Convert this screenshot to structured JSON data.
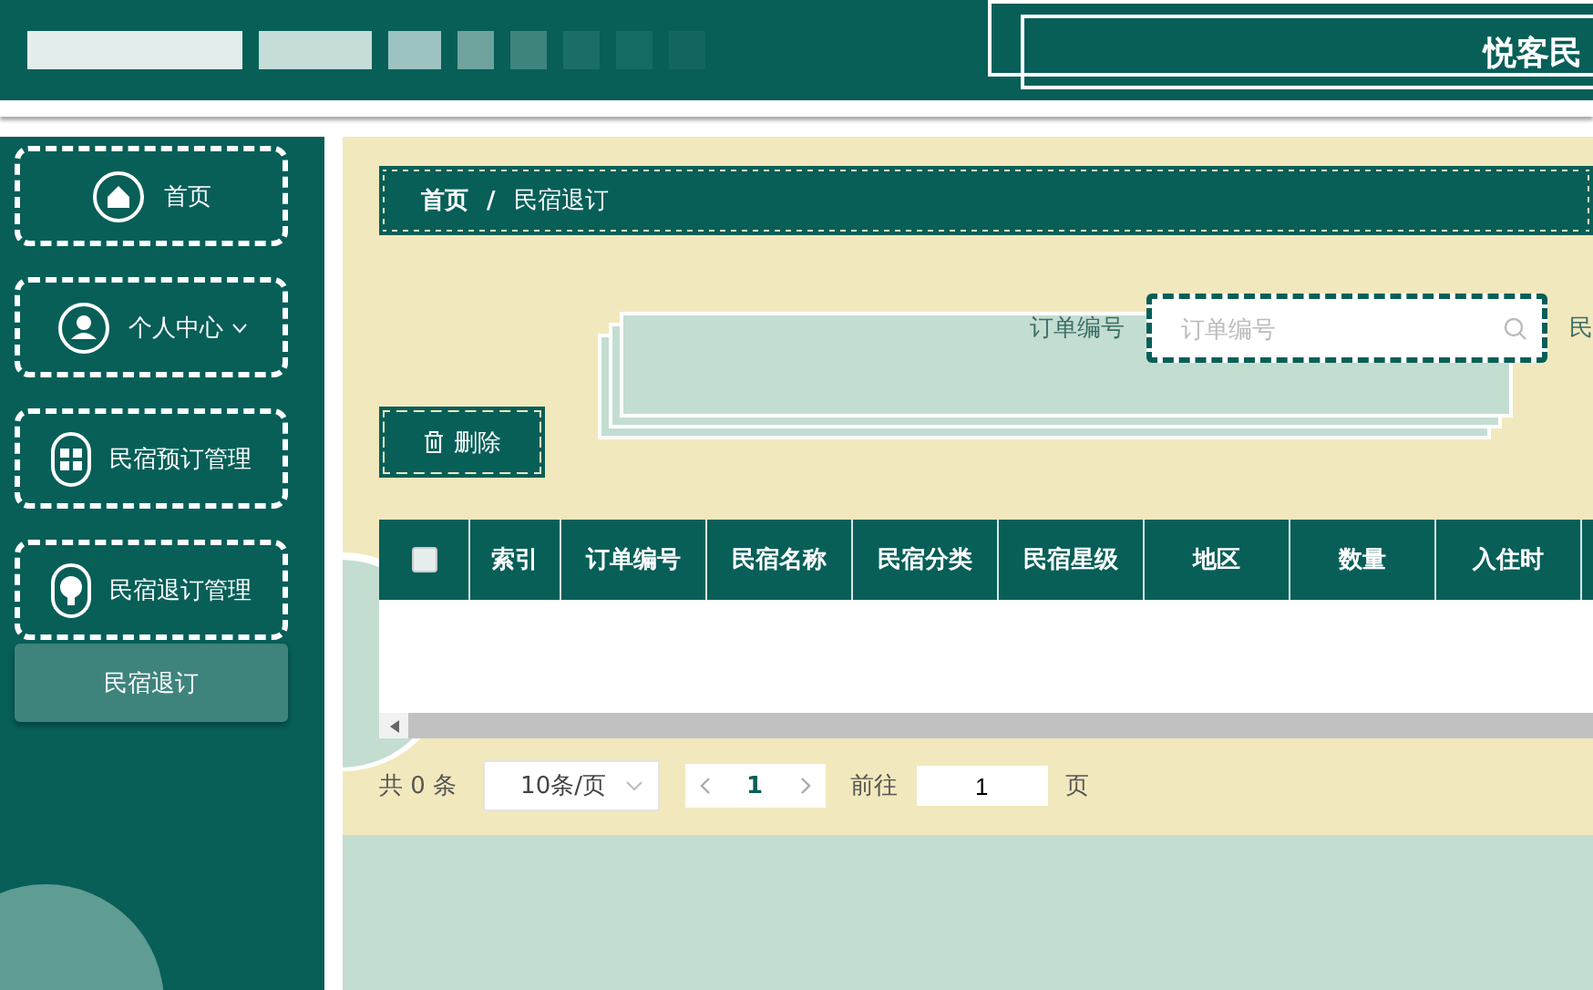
{
  "header": {
    "title": "悦客民"
  },
  "sidebar": {
    "items": [
      {
        "label": "首页",
        "kind": "home",
        "dropdown": false
      },
      {
        "label": "个人中心",
        "kind": "user",
        "dropdown": true
      },
      {
        "label": "民宿预订管理",
        "kind": "grid",
        "dropdown": false
      },
      {
        "label": "民宿退订管理",
        "kind": "bulb",
        "dropdown": false,
        "children": [
          {
            "label": "民宿退订"
          }
        ]
      }
    ]
  },
  "breadcrumb": {
    "items": [
      "首页",
      "民宿退订"
    ],
    "separator": "/"
  },
  "search": {
    "fields": [
      {
        "label": "订单编号",
        "placeholder": "订单编号"
      }
    ],
    "next_label": "民"
  },
  "toolbar": {
    "delete_button": "删除"
  },
  "table": {
    "select_all": false,
    "columns": [
      "索引",
      "订单编号",
      "民宿名称",
      "民宿分类",
      "民宿星级",
      "地区",
      "数量",
      "入住时"
    ]
  },
  "pagination": {
    "total": "共 0 条",
    "page_size": "10条/页",
    "pages": [
      {
        "label": "1",
        "selected": true
      }
    ],
    "goto_label": "前往",
    "goto_value": "1",
    "goto_suffix": "页"
  }
}
